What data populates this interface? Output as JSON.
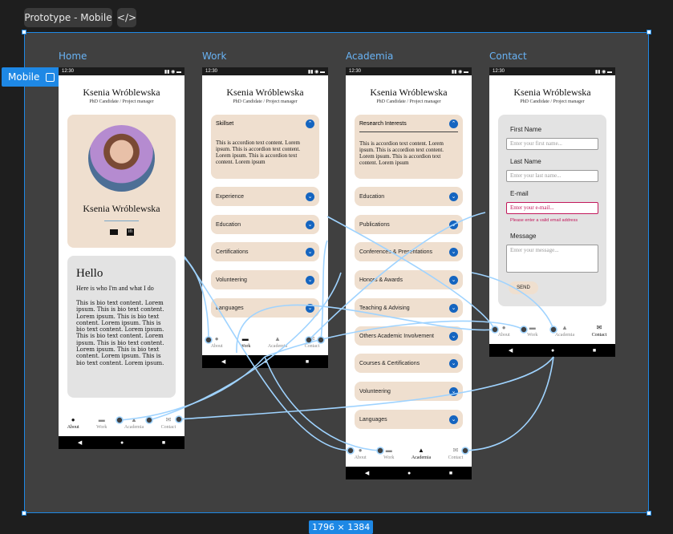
{
  "toolbar": {
    "title": "Prototype - Mobile",
    "code_icon": "code-icon",
    "code_glyph": "</>"
  },
  "badge": {
    "label": "Mobile"
  },
  "dims": "1796 × 1384",
  "frames": {
    "home": "Home",
    "work": "Work",
    "academia": "Academia",
    "contact": "Contact"
  },
  "status_time": "12:30",
  "profile": {
    "name": "Ksenia Wróblewska",
    "subtitle": "PhD Candidate / Project manager"
  },
  "home": {
    "card_name": "Ksenia Wróblewska",
    "hello": "Hello",
    "intro": "Here is who I'm and what I do",
    "bio": "This is bio text content. Lorem ipsum. This is bio text content. Lorem ipsum. This is bio text content. Lorem ipsum. This is bio text content. Lorem ipsum. This is bio text content. Lorem ipsum. This is bio text content. Lorem ipsum. This is bio text content. Lorem ipsum. This is bio text content. Lorem ipsum."
  },
  "work": {
    "open": {
      "title": "Skillset",
      "body": "This is accordion text content. Lorem ipsum. This is accordion text content. Lorem ipsum. This is accordion text content. Lorem ipsum"
    },
    "items": [
      "Experience",
      "Education",
      "Certifications",
      "Volunteering",
      "Languages"
    ]
  },
  "academia": {
    "open": {
      "title": "Research Interests",
      "body": "This is accordion text content. Lorem ipsum. This is accordion text content. Lorem ipsum. This is accordion text content. Lorem ipsum"
    },
    "items": [
      "Education",
      "Publications",
      "Conferences & Presentations",
      "Honors & Awards",
      "Teaching & Advising",
      "Others Academic Involvement",
      "Courses & Certifications",
      "Volunteering",
      "Languages"
    ]
  },
  "contact": {
    "first_label": "First Name",
    "first_ph": "Enter your first name...",
    "last_label": "Last Name",
    "last_ph": "Enter your last name...",
    "email_label": "E-mail",
    "email_ph": "Enter your e-mail...",
    "email_error": "Please enter a valid email address",
    "msg_label": "Message",
    "msg_ph": "Enter your message...",
    "send": "SEND"
  },
  "nav": [
    "About",
    "Work",
    "Academia",
    "Contact"
  ],
  "colors": {
    "accent": "#1e88e5",
    "card": "#efdfcf",
    "flow": "#9fd3ff"
  }
}
